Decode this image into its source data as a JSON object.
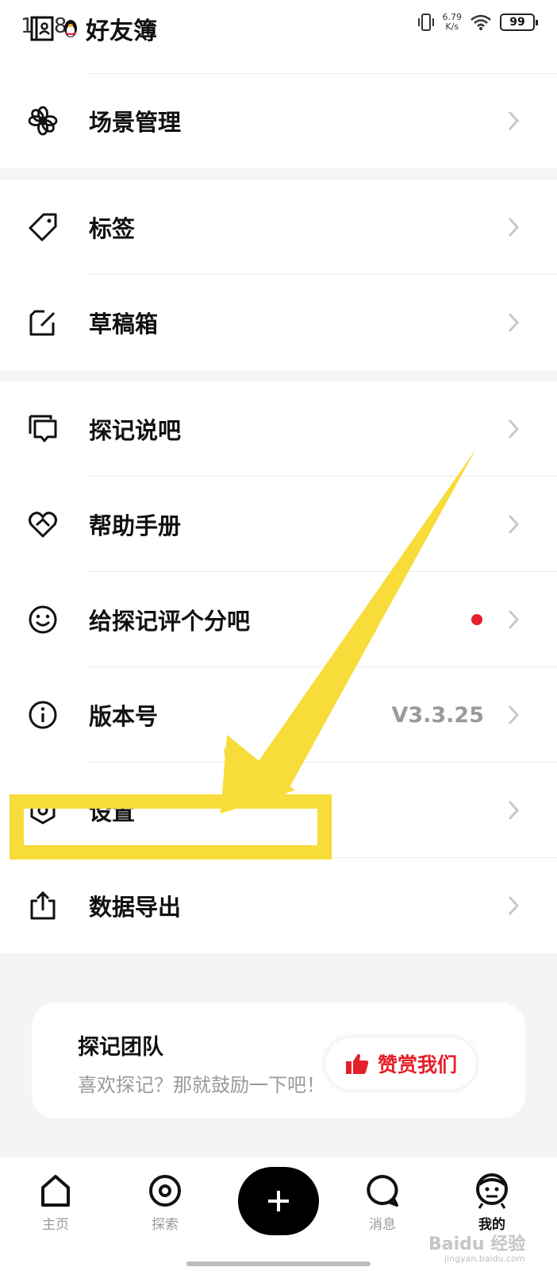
{
  "status_bar": {
    "time": "1:58",
    "net_speed_value": "6.79",
    "net_speed_unit": "K/s",
    "battery": "99"
  },
  "header": {
    "title": "好友簿"
  },
  "menu": {
    "scene": "场景管理",
    "tags": "标签",
    "drafts": "草稿箱",
    "forum": "探记说吧",
    "help": "帮助手册",
    "rate": "给探记评个分吧",
    "version": "版本号",
    "version_value": "V3.3.25",
    "settings": "设置",
    "export": "数据导出"
  },
  "team_card": {
    "title": "探记团队",
    "subtitle": "喜欢探记？那就鼓励一下吧！",
    "reward_button": "赞赏我们"
  },
  "tab_bar": {
    "home": "主页",
    "explore": "探索",
    "messages": "消息",
    "mine": "我的"
  },
  "watermark": {
    "brand": "Baidu 经验",
    "url": "jingyan.baidu.com"
  },
  "colors": {
    "highlight": "#f7dc3a",
    "red_accent": "#e5202a",
    "muted_text": "#9a9a9a"
  }
}
